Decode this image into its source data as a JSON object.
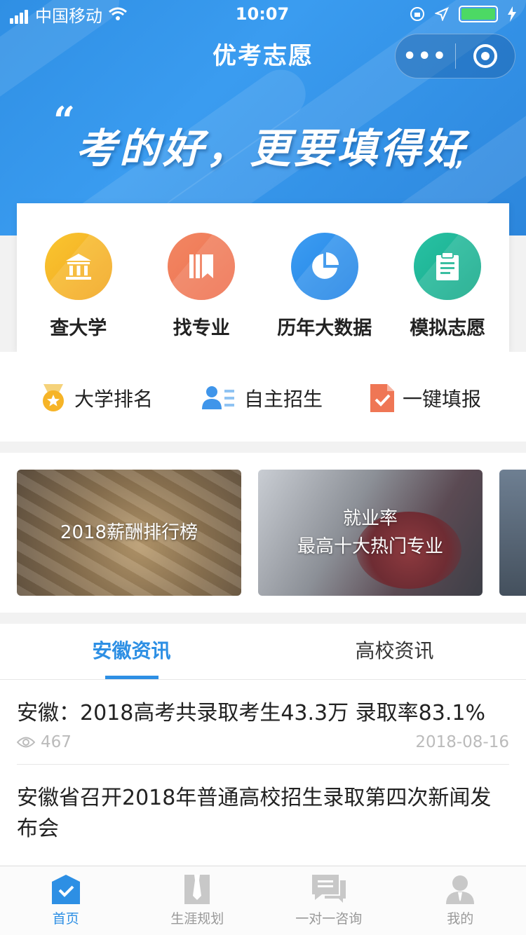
{
  "status_bar": {
    "carrier": "中国移动",
    "time": "10:07"
  },
  "nav": {
    "title": "优考志愿",
    "menu_label": "•••"
  },
  "hero": {
    "slogan": "考的好，更要填得好",
    "quote_open": "“",
    "quote_close": "”"
  },
  "main_actions": [
    {
      "label": "查大学",
      "icon": "university-icon"
    },
    {
      "label": "找专业",
      "icon": "book-icon"
    },
    {
      "label": "历年大数据",
      "icon": "pie-chart-icon"
    },
    {
      "label": "模拟志愿",
      "icon": "clipboard-icon"
    }
  ],
  "quick_links": [
    {
      "label": "大学排名",
      "icon": "medal-icon"
    },
    {
      "label": "自主招生",
      "icon": "user-list-icon"
    },
    {
      "label": "一键填报",
      "icon": "document-check-icon"
    }
  ],
  "banners": [
    {
      "line1": "2018薪酬排行榜",
      "line2": ""
    },
    {
      "line1": "就业率",
      "line2": "最高十大热门专业"
    }
  ],
  "news": {
    "tabs": [
      "安徽资讯",
      "高校资讯"
    ],
    "active_tab": "安徽资讯",
    "articles": [
      {
        "title": "安徽：2018高考共录取考生43.3万 录取率83.1%",
        "views": "467",
        "date": "2018-08-16"
      },
      {
        "title": "安徽省召开2018年普通高校招生录取第四次新闻发布会",
        "views": "",
        "date": ""
      }
    ]
  },
  "tab_bar": {
    "items": [
      {
        "label": "首页",
        "icon": "home-icon"
      },
      {
        "label": "生涯规划",
        "icon": "career-icon"
      },
      {
        "label": "一对一咨询",
        "icon": "chat-icon"
      },
      {
        "label": "我的",
        "icon": "profile-icon"
      }
    ],
    "active": "首页"
  },
  "colors": {
    "primary": "#2d8fe4",
    "yellow": "#f6b427",
    "orange": "#ef7655",
    "blue": "#2a8ee9",
    "teal": "#1fb595",
    "battery": "#4cd964"
  }
}
